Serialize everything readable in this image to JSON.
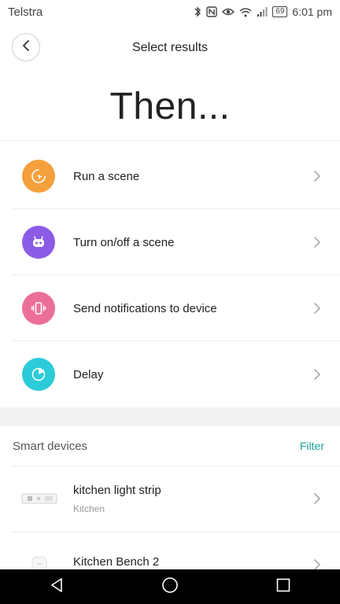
{
  "status": {
    "carrier": "Telstra",
    "battery": "69",
    "time": "6:01 pm",
    "icons": [
      "bluetooth-icon",
      "nfc-icon",
      "eye-icon",
      "wifi-icon",
      "signal-icon",
      "battery-icon"
    ]
  },
  "header": {
    "title": "Select results",
    "back_icon": "chevron-left-icon"
  },
  "hero": {
    "text": "Then..."
  },
  "actions": [
    {
      "label": "Run a scene",
      "icon": "cursor-circle-icon",
      "color": "#f5a03d"
    },
    {
      "label": "Turn on/off a scene",
      "icon": "robot-icon",
      "color": "#8b5be6"
    },
    {
      "label": "Send notifications to device",
      "icon": "vibrating-phone-icon",
      "color": "#ec6f98"
    },
    {
      "label": "Delay",
      "icon": "timer-icon",
      "color": "#2ccbd9"
    }
  ],
  "smart_devices": {
    "title": "Smart devices",
    "filter": "Filter",
    "filter_color": "#1aa69b",
    "items": [
      {
        "name": "kitchen light strip",
        "room": "Kitchen",
        "icon": "light-strip-icon"
      },
      {
        "name": "Kitchen Bench 2",
        "room": "",
        "icon": "bulb-device-icon"
      }
    ]
  },
  "navbar": {
    "icons": [
      "back-triangle-icon",
      "home-circle-icon",
      "recents-square-icon"
    ]
  }
}
